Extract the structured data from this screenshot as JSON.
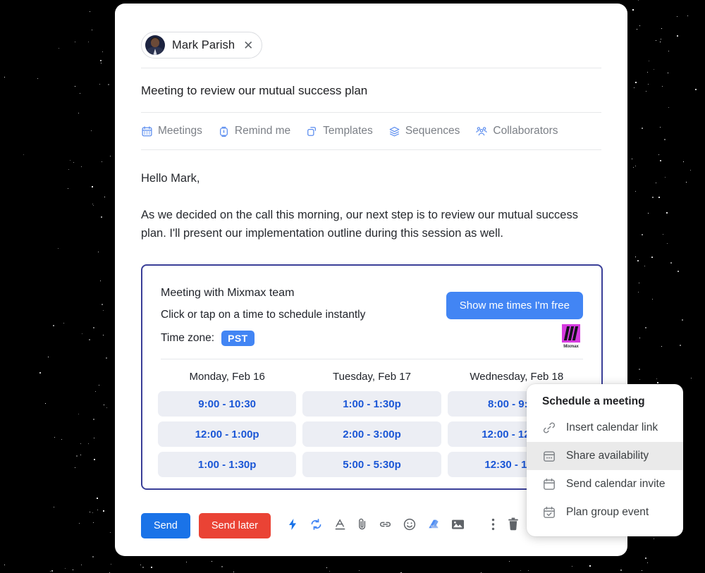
{
  "compose": {
    "recipient": {
      "name": "Mark Parish",
      "close_icon": "close-icon",
      "avatar": "avatar"
    },
    "subject": "Meeting to review our mutual success plan",
    "feature_bar": [
      {
        "label": "Meetings",
        "icon": "calendar-icon"
      },
      {
        "label": "Remind me",
        "icon": "stopwatch-icon"
      },
      {
        "label": "Templates",
        "icon": "copy-icon"
      },
      {
        "label": "Sequences",
        "icon": "layers-icon"
      },
      {
        "label": "Collaborators",
        "icon": "people-icon"
      }
    ],
    "body": [
      "Hello Mark,",
      "As we decided on the call this morning, our next step is to review our mutual success plan. I'll present our implementation outline during this session as well."
    ]
  },
  "meeting_widget": {
    "title": "Meeting with Mixmax team",
    "subtitle": "Click or tap on a time to schedule instantly",
    "timezone_label": "Time zone:",
    "timezone_value": "PST",
    "show_free_button": "Show me times I'm free",
    "brand_name": "Mixmax",
    "columns": [
      {
        "day": "Monday, Feb 16",
        "slots": [
          "9:00 - 10:30",
          "12:00 - 1:00p",
          "1:00 - 1:30p"
        ]
      },
      {
        "day": "Tuesday, Feb 17",
        "slots": [
          "1:00 - 1:30p",
          "2:00 - 3:00p",
          "5:00 - 5:30p"
        ]
      },
      {
        "day": "Wednesday, Feb 18",
        "slots": [
          "8:00 - 9:00a",
          "12:00 - 12:30p",
          "12:30 - 1:00p"
        ]
      }
    ]
  },
  "action_bar": {
    "send_label": "Send",
    "send_later_label": "Send later",
    "icons": [
      "lightning-icon",
      "sync-icon",
      "text-format-icon",
      "attach-icon",
      "link-icon",
      "emoji-icon",
      "drive-icon",
      "image-icon"
    ],
    "right_icons": [
      "more-vertical-icon",
      "trash-icon"
    ]
  },
  "schedule_menu": {
    "title": "Schedule a meeting",
    "items": [
      {
        "label": "Insert calendar link",
        "icon": "link-chain-icon",
        "active": false
      },
      {
        "label": "Share availability",
        "icon": "calendar-dots-icon",
        "active": true
      },
      {
        "label": "Send calendar invite",
        "icon": "calendar-blank-icon",
        "active": false
      },
      {
        "label": "Plan group event",
        "icon": "calendar-check-icon",
        "active": false
      }
    ]
  },
  "colors": {
    "accent_blue": "#4285f4",
    "send_blue": "#1a73e8",
    "send_later_red": "#ea4335",
    "widget_border": "#3a3f98",
    "slot_bg": "#eceef4",
    "slot_text": "#1a56d6",
    "brand_magenta": "#d63ae0"
  }
}
